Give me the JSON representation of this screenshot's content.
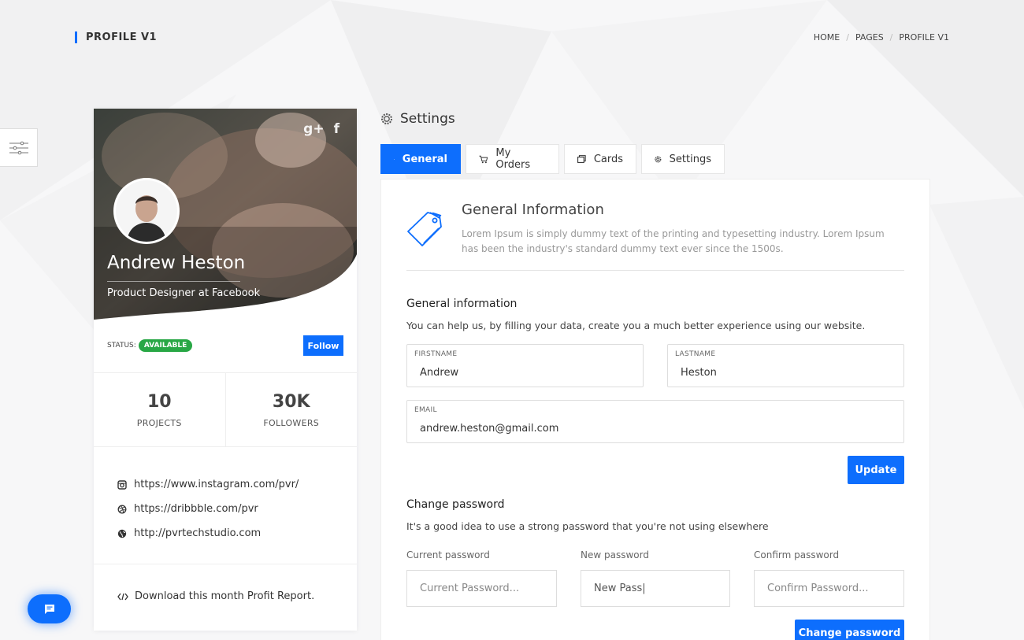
{
  "header": {
    "title": "PROFILE V1",
    "breadcrumb": [
      "HOME",
      "PAGES",
      "PROFILE V1"
    ]
  },
  "profile": {
    "name": "Andrew Heston",
    "role": "Product Designer at Facebook",
    "social": [
      "g+",
      "f"
    ],
    "status_label": "STATUS:",
    "status_value": "AVAILABLE",
    "follow_label": "Follow",
    "stats": [
      {
        "value": "10",
        "label": "PROJECTS"
      },
      {
        "value": "30K",
        "label": "FOLLOWERS"
      }
    ],
    "links": [
      {
        "icon": "instagram-icon",
        "text": "https://www.instagram.com/pvr/"
      },
      {
        "icon": "dribbble-icon",
        "text": "https://dribbble.com/pvr"
      },
      {
        "icon": "globe-icon",
        "text": "http://pvrtechstudio.com"
      }
    ],
    "download_text": "Download this month Profit Report."
  },
  "settings": {
    "title": "Settings",
    "tabs": [
      {
        "label": "General",
        "icon": "id-card-icon",
        "active": true
      },
      {
        "label": "My Orders",
        "icon": "cart-icon",
        "active": false
      },
      {
        "label": "Cards",
        "icon": "card-icon",
        "active": false
      },
      {
        "label": "Settings",
        "icon": "gear-icon",
        "active": false
      }
    ],
    "intro": {
      "title": "General Information",
      "text": "Lorem Ipsum is simply dummy text of the printing and typesetting industry. Lorem Ipsum has been the industry's standard dummy text ever since the 1500s."
    },
    "general": {
      "title": "General information",
      "description": "You can help us, by filling your data, create you a much better experience using our website.",
      "firstname_label": "FIRSTNAME",
      "firstname": "Andrew",
      "lastname_label": "LASTNAME",
      "lastname": "Heston",
      "email_label": "EMAIL",
      "email": "andrew.heston@gmail.com",
      "update_label": "Update"
    },
    "password": {
      "title": "Change password",
      "description": "It's a good idea to use a strong password that you're not using elsewhere",
      "current_label": "Current password",
      "current_placeholder": "Current Password...",
      "new_label": "New password",
      "new_value": "New Pass|",
      "confirm_label": "Confirm password",
      "confirm_placeholder": "Confirm Password...",
      "submit_label": "Change password"
    }
  },
  "colors": {
    "accent": "#0d6efd",
    "status_green": "#28a745"
  }
}
